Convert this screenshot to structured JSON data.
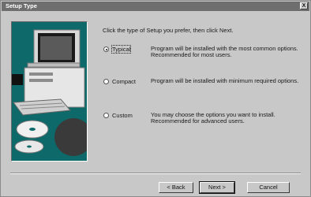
{
  "window": {
    "title": "Setup Type",
    "close_glyph": "X"
  },
  "illustration": {
    "name": "computer-with-cds-illustration"
  },
  "instruction": "Click the type of Setup you prefer, then click Next.",
  "options": [
    {
      "label": "Typical",
      "selected": true,
      "description": "Program will be installed with the most common options. Recommended for most users."
    },
    {
      "label": "Compact",
      "selected": false,
      "description": "Program will be installed with minimum required options."
    },
    {
      "label": "Custom",
      "selected": false,
      "description": "You may choose the options you want to install. Recommended for advanced users."
    }
  ],
  "buttons": {
    "back": "< Back",
    "next": "Next >",
    "cancel": "Cancel"
  },
  "colors": {
    "titlebar": "#6e6e6e",
    "dialog": "#c8c8c8",
    "illustration_bg": "#0e6a6a"
  }
}
